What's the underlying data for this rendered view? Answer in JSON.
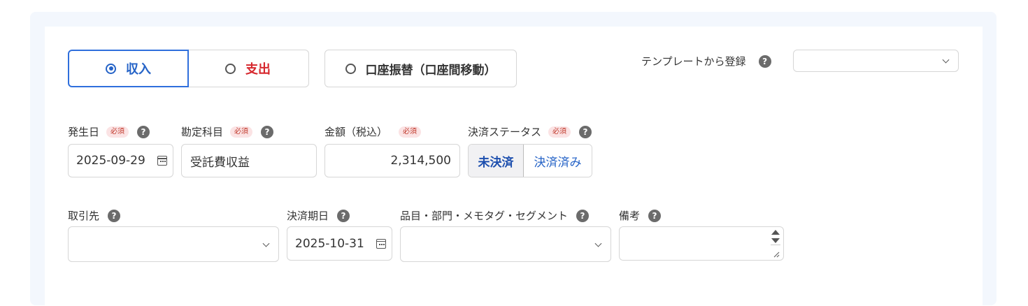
{
  "type_tabs": {
    "income": "収入",
    "expense": "支出",
    "transfer": "口座振替（口座間移動）"
  },
  "template": {
    "label": "テンプレートから登録",
    "value": ""
  },
  "required_badge": "必須",
  "help_glyph": "?",
  "fields": {
    "issue_date": {
      "label": "発生日",
      "value": "2025-09-29"
    },
    "account": {
      "label": "勘定科目",
      "value": "受託費収益"
    },
    "amount": {
      "label": "金額（税込）",
      "value": "2,314,500"
    },
    "status": {
      "label": "決済ステータス",
      "options": [
        "未決済",
        "決済済み"
      ],
      "selected": "未決済"
    },
    "partner": {
      "label": "取引先",
      "value": ""
    },
    "due_date": {
      "label": "決済期日",
      "value": "2025-10-31"
    },
    "tags": {
      "label": "品目・部門・メモタグ・セグメント",
      "value": ""
    },
    "remarks": {
      "label": "備考",
      "value": ""
    }
  },
  "colors": {
    "income": "#2563c7",
    "expense": "#d6282e",
    "accent_border": "#2f6fdc"
  }
}
